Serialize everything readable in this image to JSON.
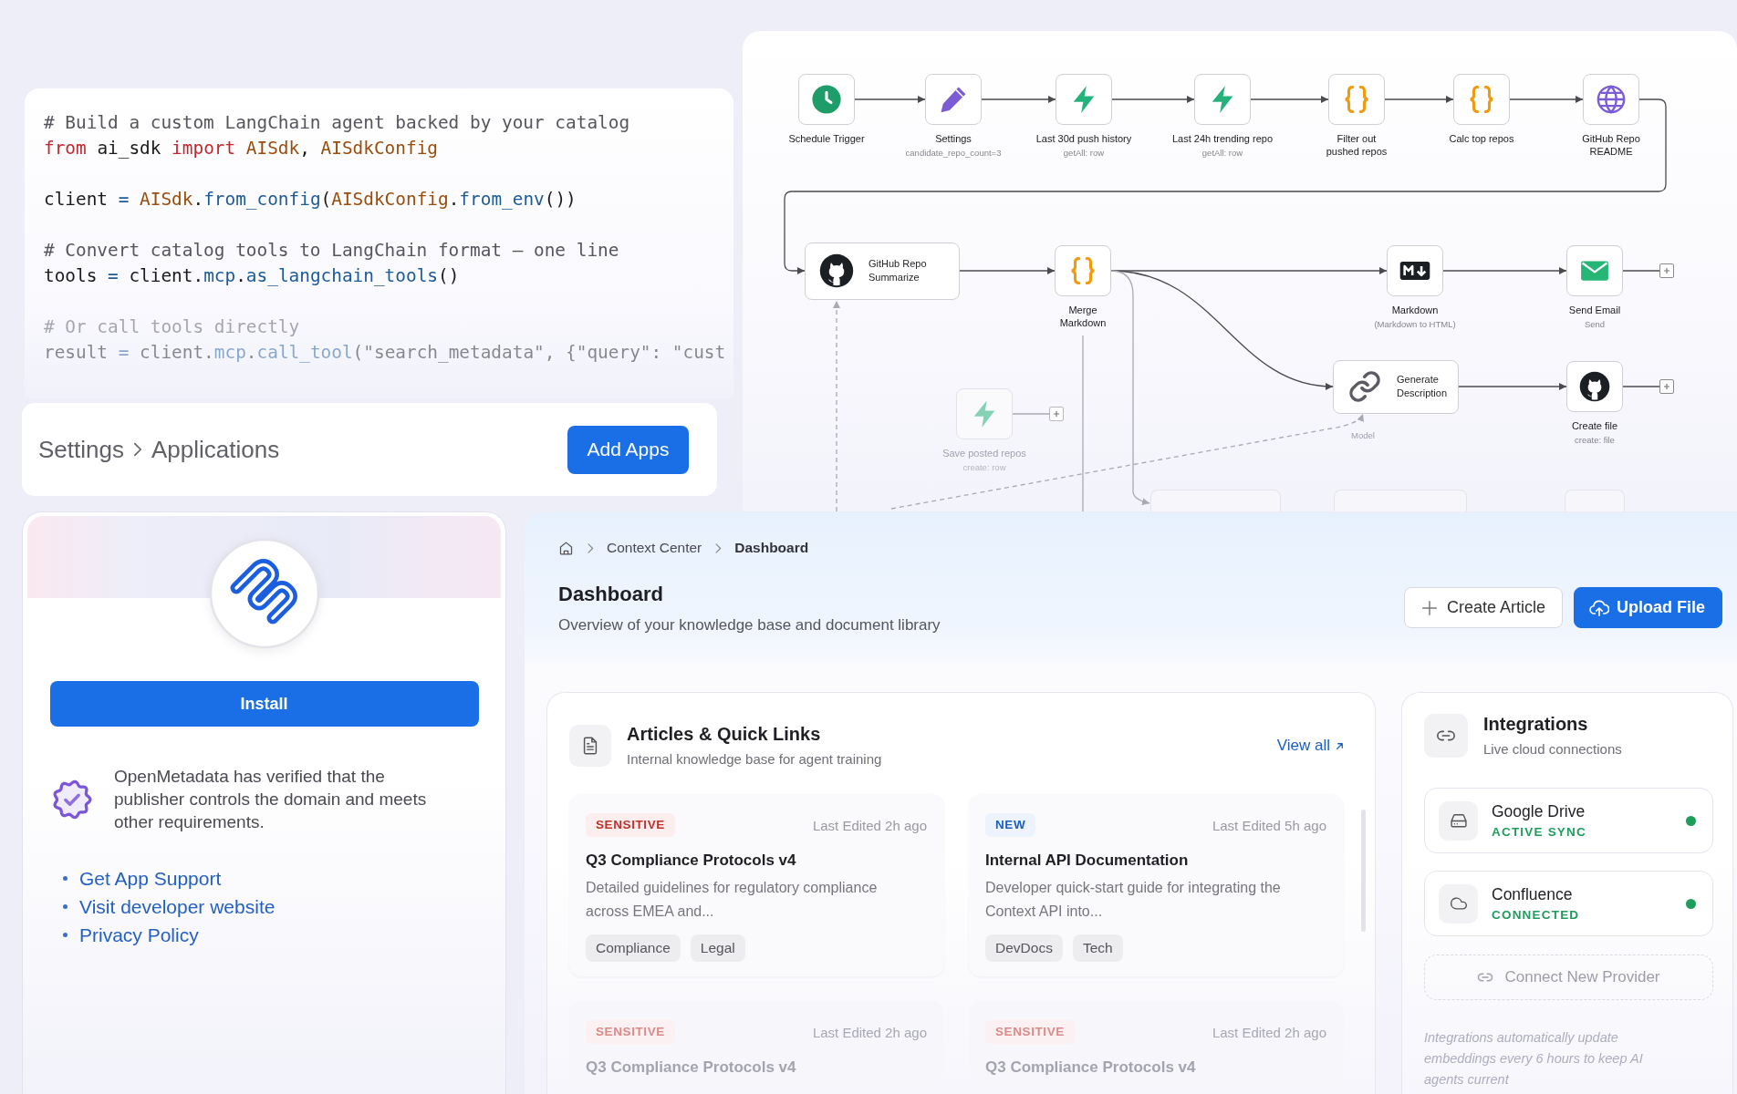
{
  "code_panel": {
    "blocks": [
      {
        "lines": [
          {
            "faded": false,
            "tokens": [
              {
                "kind": "comment",
                "text": "# Build a custom LangChain agent backed by your catalog"
              }
            ]
          },
          {
            "faded": false,
            "tokens": [
              {
                "kind": "keyword",
                "text": "from"
              },
              {
                "kind": "plain",
                "text": " ai_sdk "
              },
              {
                "kind": "keyword",
                "text": "import "
              },
              {
                "kind": "class",
                "text": "AISdk"
              },
              {
                "kind": "plain",
                "text": ", "
              },
              {
                "kind": "class",
                "text": "AISdkConfig"
              }
            ]
          }
        ]
      },
      {
        "lines": [
          {
            "faded": false,
            "tokens": [
              {
                "kind": "plain",
                "text": "client"
              },
              {
                "kind": "operator",
                "text": " = "
              },
              {
                "kind": "class",
                "text": "AISdk"
              },
              {
                "kind": "plain",
                "text": "."
              },
              {
                "kind": "func",
                "text": "from_config"
              },
              {
                "kind": "plain",
                "text": "("
              },
              {
                "kind": "class",
                "text": "AISdkConfig"
              },
              {
                "kind": "plain",
                "text": "."
              },
              {
                "kind": "func",
                "text": "from_env"
              },
              {
                "kind": "plain",
                "text": "())"
              }
            ]
          }
        ]
      },
      {
        "lines": [
          {
            "faded": false,
            "tokens": [
              {
                "kind": "comment",
                "text": "# Convert catalog tools to LangChain format — one line"
              }
            ]
          },
          {
            "faded": false,
            "tokens": [
              {
                "kind": "plain",
                "text": "tools"
              },
              {
                "kind": "operator",
                "text": " = "
              },
              {
                "kind": "plain",
                "text": "client."
              },
              {
                "kind": "func",
                "text": "mcp"
              },
              {
                "kind": "plain",
                "text": "."
              },
              {
                "kind": "func",
                "text": "as_langchain_tools"
              },
              {
                "kind": "plain",
                "text": "()"
              }
            ]
          }
        ]
      },
      {
        "lines": [
          {
            "faded": true,
            "tokens": [
              {
                "kind": "comment",
                "text": "# Or call tools directly"
              }
            ]
          },
          {
            "faded": true,
            "tokens": [
              {
                "kind": "plain",
                "text": "result"
              },
              {
                "kind": "operator",
                "text": " = "
              },
              {
                "kind": "plain",
                "text": "client."
              },
              {
                "kind": "func",
                "text": "mcp"
              },
              {
                "kind": "plain",
                "text": "."
              },
              {
                "kind": "func",
                "text": "call_tool"
              },
              {
                "kind": "plain",
                "text": "(\"search_metadata\", {\"query\": \"cust"
              }
            ]
          }
        ]
      }
    ]
  },
  "settings_bar": {
    "breadcrumb": [
      "Settings",
      "Applications"
    ],
    "button": "Add Apps"
  },
  "workflow": {
    "nodes": [
      {
        "kind": "schedule",
        "wide": false,
        "label": "Schedule Trigger",
        "faded": false,
        "add_handle": false
      },
      {
        "kind": "edit",
        "wide": false,
        "label": "Settings",
        "sublabel": "candidate_repo_count=3",
        "faded": false,
        "add_handle": false
      },
      {
        "kind": "bolt",
        "wide": false,
        "label": "Last 30d push history",
        "sublabel": "getAll: row",
        "faded": false,
        "add_handle": false
      },
      {
        "kind": "bolt",
        "wide": false,
        "label": "Last 24h trending repo",
        "sublabel": "getAll: row",
        "faded": false,
        "add_handle": false
      },
      {
        "kind": "code",
        "wide": false,
        "label": "Filter out\npushed repos",
        "faded": false,
        "add_handle": false
      },
      {
        "kind": "code",
        "wide": false,
        "label": "Calc top repos",
        "faded": false,
        "add_handle": false
      },
      {
        "kind": "http",
        "wide": false,
        "label": "GitHub Repo\nREADME",
        "faded": false,
        "add_handle": false
      },
      {
        "kind": "github",
        "wide": true,
        "label": "GitHub Repo\nSummarize",
        "faded": false,
        "add_handle": false
      },
      {
        "kind": "code",
        "wide": false,
        "label": "Merge\nMarkdown",
        "faded": false,
        "add_handle": false
      },
      {
        "kind": "markdown",
        "wide": false,
        "label": "Markdown",
        "sublabel": "(Markdown to HTML)",
        "faded": false,
        "add_handle": false
      },
      {
        "kind": "email",
        "wide": false,
        "label": "Send Email",
        "sublabel": "Send",
        "faded": false,
        "add_handle": true
      },
      {
        "kind": "chain",
        "wide": true,
        "label": "Generate\nDescription",
        "faded": false,
        "add_handle": false
      },
      {
        "kind": "github",
        "wide": false,
        "label": "Create file",
        "sublabel": "create: file",
        "faded": false,
        "add_handle": true
      },
      {
        "kind": "bolt",
        "wide": false,
        "label": "Save posted repos",
        "sublabel": "create: row",
        "faded": true,
        "add_handle": true
      }
    ],
    "connection_label": "Model"
  },
  "app_card": {
    "install_button": "Install",
    "verification": "OpenMetadata has verified that the publisher controls the domain and meets other requirements.",
    "links": [
      "Get App Support",
      "Visit developer website",
      "Privacy Policy"
    ]
  },
  "dashboard": {
    "breadcrumb": [
      {
        "label": "Context Center",
        "current": false
      },
      {
        "label": "Dashboard",
        "current": true
      }
    ],
    "title": "Dashboard",
    "subtitle": "Overview of your knowledge base and document library",
    "buttons": [
      {
        "kind": "secondary",
        "label": "Create Article"
      },
      {
        "kind": "primary",
        "label": "Upload File"
      }
    ],
    "articles": {
      "title": "Articles & Quick Links",
      "subtitle": "Internal knowledge base for agent training",
      "link": "View all",
      "items": [
        {
          "badge": {
            "kind": "sensitive",
            "label": "SENSITIVE"
          },
          "edited": "Last Edited 2h ago",
          "title": "Q3 Compliance Protocols v4",
          "description": "Detailed guidelines for regulatory compliance across EMEA and...",
          "tags": [
            "Compliance",
            "Legal"
          ],
          "faded": false
        },
        {
          "badge": {
            "kind": "new",
            "label": "NEW"
          },
          "edited": "Last Edited 5h ago",
          "title": "Internal API Documentation",
          "description": "Developer quick-start guide for integrating the Context API into...",
          "tags": [
            "DevDocs",
            "Tech"
          ],
          "faded": false
        },
        {
          "badge": {
            "kind": "sensitive",
            "label": "SENSITIVE"
          },
          "edited": "Last Edited 2h ago",
          "title": "Q3 Compliance Protocols v4",
          "faded": true
        },
        {
          "badge": {
            "kind": "sensitive",
            "label": "SENSITIVE"
          },
          "edited": "Last Edited 2h ago",
          "title": "Q3 Compliance Protocols v4",
          "faded": true
        }
      ]
    },
    "integrations": {
      "title": "Integrations",
      "subtitle": "Live cloud connections",
      "items": [
        {
          "kind": "drive",
          "name": "Google Drive",
          "status": "ACTIVE SYNC",
          "color": "#1f9d5c"
        },
        {
          "kind": "cloud",
          "name": "Confluence",
          "status": "CONNECTED",
          "color": "#1f9d5c"
        }
      ],
      "connect_button": "Connect New Provider",
      "note": "Integrations automatically update embeddings every 6 hours to keep AI agents current"
    }
  }
}
